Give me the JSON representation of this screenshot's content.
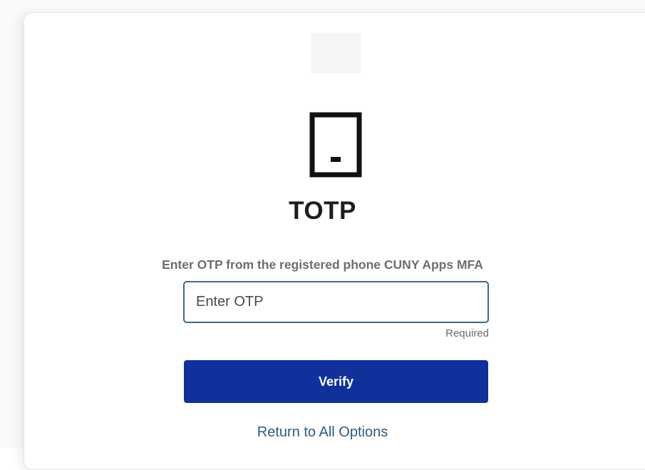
{
  "mfa": {
    "icon": "phone-icon",
    "title": "TOTP",
    "instruction": "Enter OTP from the registered phone CUNY Apps MFA",
    "otp_input": {
      "placeholder": "Enter OTP",
      "value": ""
    },
    "required_label": "Required",
    "verify_label": "Verify",
    "return_label": "Return to All Options"
  },
  "colors": {
    "primary_button": "#10309b",
    "link": "#2a5b82",
    "input_border": "#3c6a8a"
  }
}
